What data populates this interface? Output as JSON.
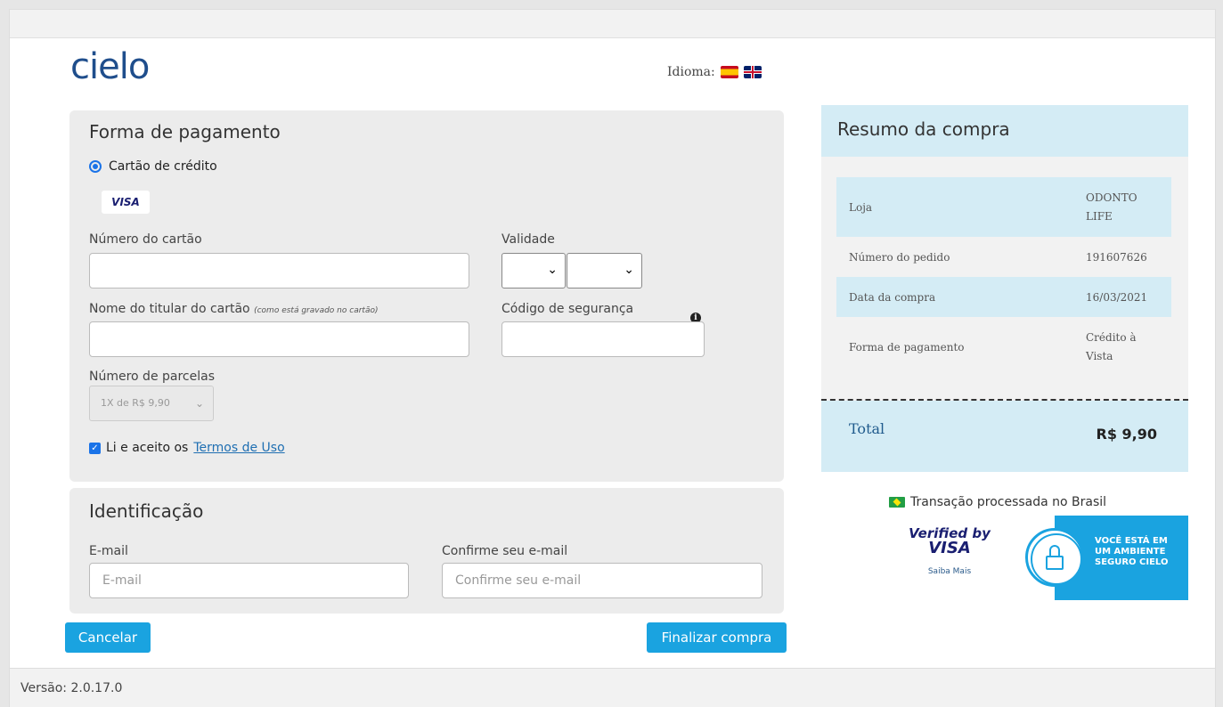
{
  "header": {
    "logo_text": "cielo",
    "language_label": "Idioma:"
  },
  "payment": {
    "title": "Forma de pagamento",
    "method_label": "Cartão de crédito",
    "card_brand": "VISA",
    "card_number_label": "Número do cartão",
    "card_number_value": "",
    "expiry_label": "Validade",
    "holder_label": "Nome do titular do cartão",
    "holder_hint": "(como está gravado no cartão)",
    "holder_value": "",
    "cvv_label": "Código de segurança",
    "cvv_value": "",
    "installments_label": "Número de parcelas",
    "installments_value": "1X de R$ 9,90",
    "terms_prefix": "Li e aceito os",
    "terms_link": "Termos de Uso"
  },
  "identification": {
    "title": "Identificação",
    "email_label": "E-mail",
    "email_placeholder": "E-mail",
    "confirm_label": "Confirme seu e-mail",
    "confirm_placeholder": "Confirme seu e-mail"
  },
  "actions": {
    "cancel": "Cancelar",
    "finish": "Finalizar compra"
  },
  "summary": {
    "title": "Resumo da compra",
    "rows": [
      {
        "key": "Loja",
        "value": "ODONTO LIFE"
      },
      {
        "key": "Número do pedido",
        "value": "191607626"
      },
      {
        "key": "Data da compra",
        "value": "16/03/2021"
      },
      {
        "key": "Forma de pagamento",
        "value": "Crédito à Vista"
      }
    ],
    "total_label": "Total",
    "total_value": "R$ 9,90"
  },
  "trust": {
    "brazil_note": "Transação processada no Brasil",
    "verified_line1": "Verified by",
    "verified_line2": "VISA",
    "verified_link": "Saiba Mais",
    "secure_line1": "VOCÊ ESTÁ EM",
    "secure_line2": "UM AMBIENTE",
    "secure_line3": "SEGURO CIELO"
  },
  "footer": {
    "version": "Versão: 2.0.17.0"
  },
  "colors": {
    "accent": "#1aa3e0",
    "brand_dark": "#1f4e8c",
    "summary_bg": "#d4ecf5"
  }
}
